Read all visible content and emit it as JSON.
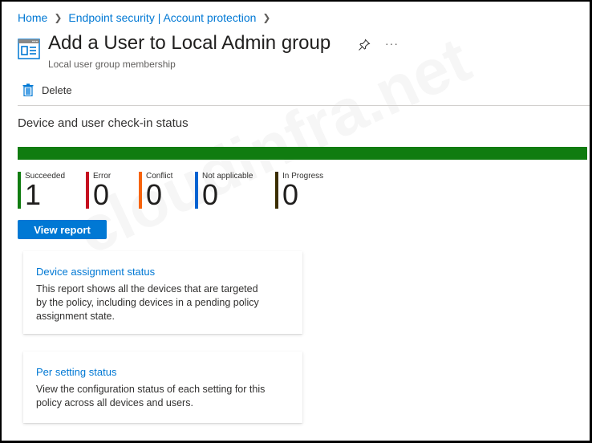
{
  "breadcrumb": [
    {
      "label": "Home"
    },
    {
      "label": "Endpoint security | Account protection"
    }
  ],
  "header": {
    "title": "Add a User to Local Admin group",
    "subtitle": "Local user group membership",
    "icons": {
      "page": "policy-window-icon",
      "pin": "pin-icon",
      "more": "more-icon"
    },
    "more_label": "···"
  },
  "toolbar": {
    "delete_label": "Delete"
  },
  "checkin": {
    "title": "Device and user check-in status",
    "progress_succeeded_fraction": 1.0,
    "stats": [
      {
        "label": "Succeeded",
        "value": "1",
        "color": "#107c10"
      },
      {
        "label": "Error",
        "value": "0",
        "color": "#c50f1f"
      },
      {
        "label": "Conflict",
        "value": "0",
        "color": "#f7630c"
      },
      {
        "label": "Not applicable",
        "value": "0",
        "color": "#0063d1"
      },
      {
        "label": "In Progress",
        "value": "0",
        "color": "#3b2e00"
      }
    ],
    "view_report_label": "View report"
  },
  "cards": [
    {
      "title": "Device assignment status",
      "description": "This report shows all the devices that are targeted by the policy, including devices in a pending policy assignment state."
    },
    {
      "title": "Per setting status",
      "description": "View the configuration status of each setting for this policy across all devices and users."
    }
  ],
  "watermark": "cloudinfra.net"
}
